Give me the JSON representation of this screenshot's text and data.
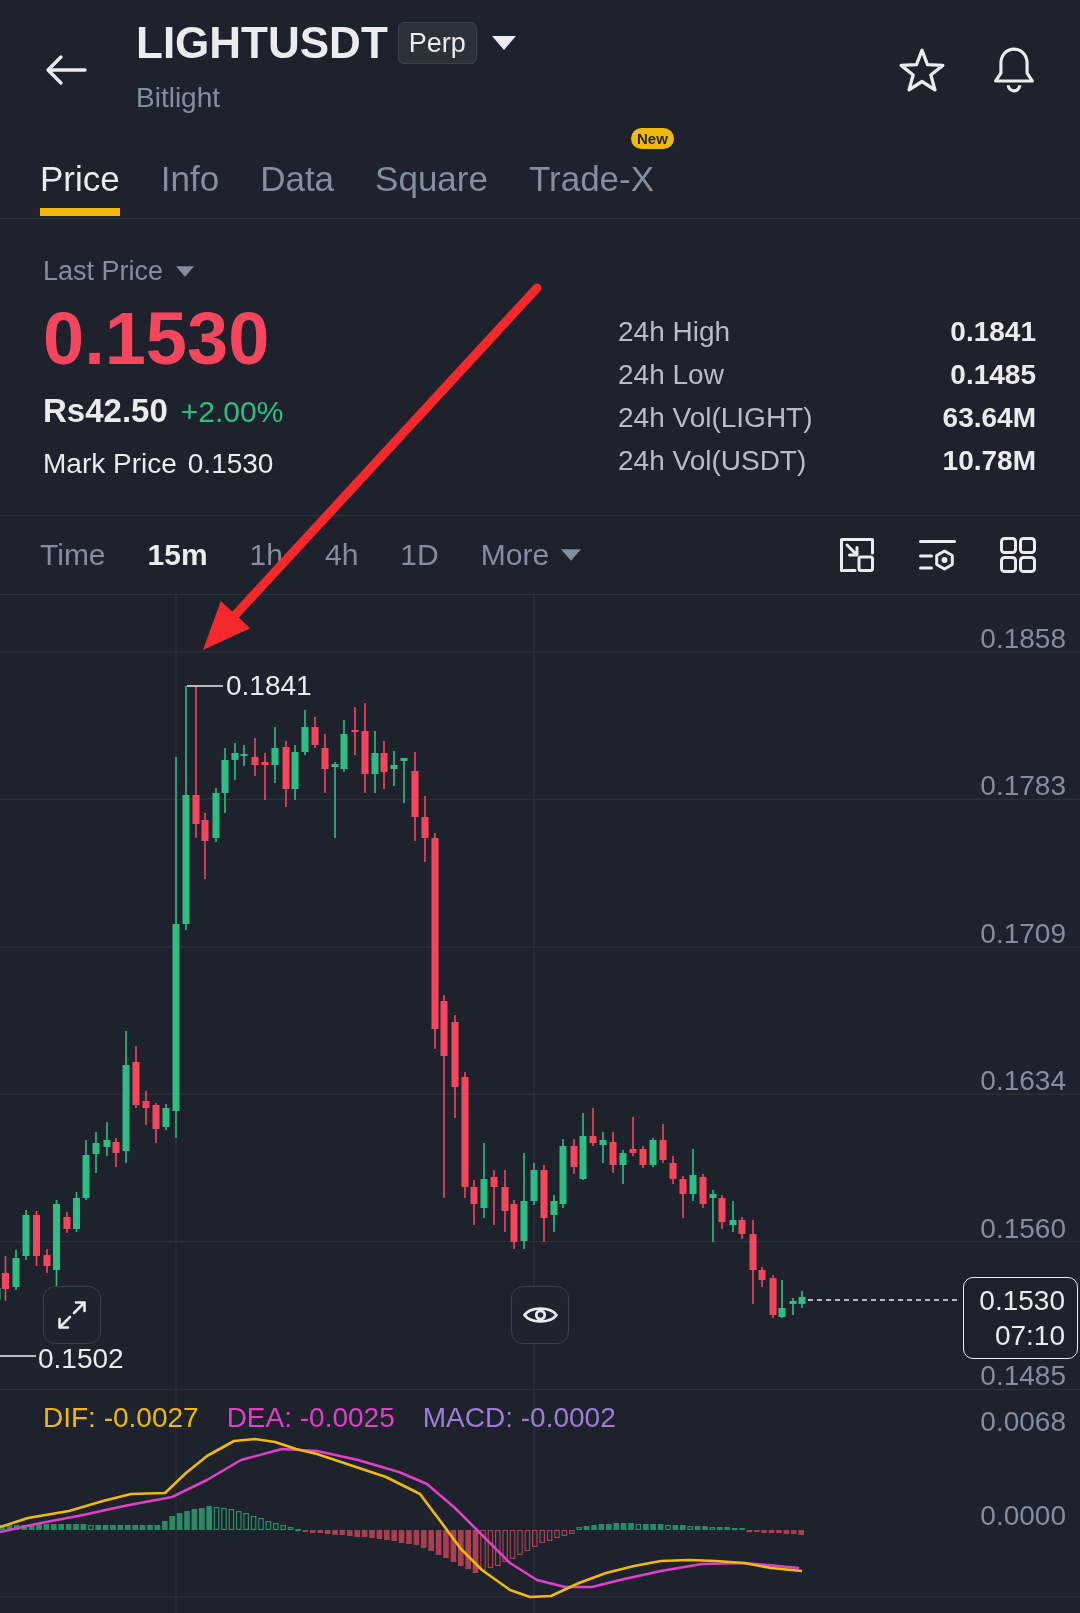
{
  "header": {
    "symbol": "LIGHTUSDT",
    "badge": "Perp",
    "name": "Bitlight"
  },
  "tabs": [
    {
      "label": "Price",
      "selected": true
    },
    {
      "label": "Info",
      "selected": false
    },
    {
      "label": "Data",
      "selected": false
    },
    {
      "label": "Square",
      "selected": false
    },
    {
      "label": "Trade-X",
      "selected": false,
      "badge": "New"
    }
  ],
  "price_panel": {
    "price_type": "Last Price",
    "last_price": "0.1530",
    "last_price_falling": true,
    "fiat_price": "Rs42.50",
    "change": "+2.00%",
    "mark_price_label": "Mark Price",
    "mark_price": "0.1530"
  },
  "stats": [
    {
      "label": "24h High",
      "value": "0.1841"
    },
    {
      "label": "24h Low",
      "value": "0.1485"
    },
    {
      "label": "24h Vol(LIGHT)",
      "value": "63.64M"
    },
    {
      "label": "24h Vol(USDT)",
      "value": "10.78M"
    }
  ],
  "intervals": [
    {
      "label": "Time",
      "kind": "option",
      "selected": false
    },
    {
      "label": "15m",
      "kind": "option",
      "selected": true
    },
    {
      "label": "1h",
      "kind": "option",
      "selected": false
    },
    {
      "label": "4h",
      "kind": "option",
      "selected": false
    },
    {
      "label": "1D",
      "kind": "option",
      "selected": false
    },
    {
      "label": "More",
      "kind": "menu",
      "selected": false
    }
  ],
  "chart": {
    "price_axis": [
      "0.1858",
      "0.1783",
      "0.1709",
      "0.1634",
      "0.1560",
      "0.1485"
    ],
    "high_marker": "0.1841",
    "low_marker": "0.1502",
    "current_price": "0.1530",
    "countdown": "07:10"
  },
  "macd": {
    "legend": [
      {
        "label": "DIF: -0.0027",
        "color": "#f0b90b"
      },
      {
        "label": "DEA: -0.0025",
        "color": "#e040c8"
      },
      {
        "label": "MACD: -0.0002",
        "color": "#9d7fd8"
      }
    ],
    "axis": [
      "0.0068",
      "0.0000"
    ]
  }
}
